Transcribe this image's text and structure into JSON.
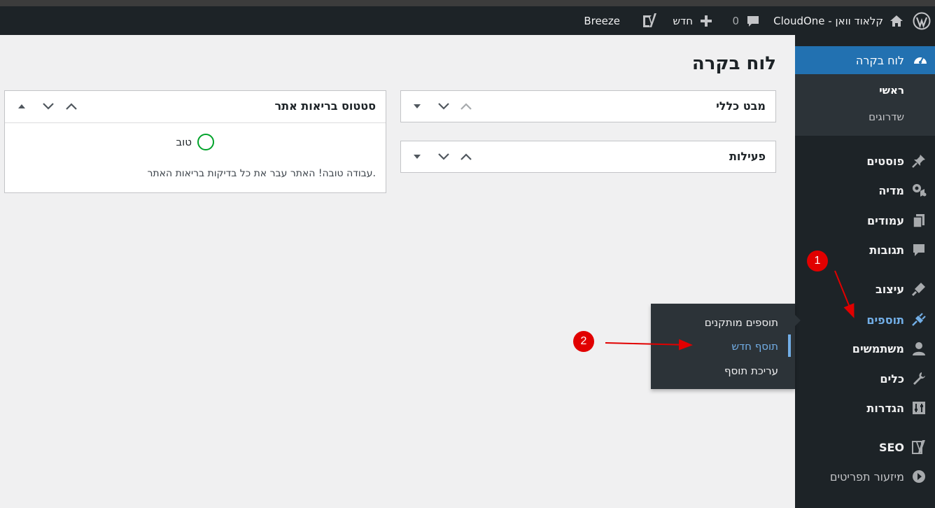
{
  "adminbar": {
    "site_name": "CloudOne - קלאוד וואן",
    "comments_count": "0",
    "new_label": "חדש",
    "breeze_label": "Breeze"
  },
  "sidebar": {
    "dashboard_label": "לוח בקרה",
    "dashboard_submenu": {
      "main": "ראשי",
      "upgrades": "שדרוגים"
    },
    "items": [
      {
        "label": "פוסטים",
        "icon": "pin-icon"
      },
      {
        "label": "מדיה",
        "icon": "media-icon"
      },
      {
        "label": "עמודים",
        "icon": "pages-icon"
      },
      {
        "label": "תגובות",
        "icon": "comments-icon"
      },
      {
        "label": "עיצוב",
        "icon": "appearance-icon"
      },
      {
        "label": "תוספים",
        "icon": "plugins-icon"
      },
      {
        "label": "משתמשים",
        "icon": "users-icon"
      },
      {
        "label": "כלים",
        "icon": "tools-icon"
      },
      {
        "label": "הגדרות",
        "icon": "settings-icon"
      },
      {
        "label": "SEO",
        "icon": "yoast-icon"
      },
      {
        "label": "מיזעור תפריטים",
        "icon": "collapse-icon"
      }
    ]
  },
  "plugins_flyout": {
    "items": [
      "תוספים מותקנים",
      "תוסף חדש",
      "עריכת תוסף"
    ]
  },
  "main": {
    "page_title": "לוח בקרה",
    "widgets": {
      "overview": "מבט כללי",
      "activity": "פעילות",
      "site_health": "סטטוס בריאות אתר"
    },
    "site_health": {
      "status": "טוב",
      "message": "עבודה טובה! האתר עבר את כל בדיקות בריאות האתר."
    }
  },
  "annotations": {
    "step1": "1",
    "step2": "2"
  },
  "colors": {
    "accent": "#2271b1",
    "active_link": "#72aee6",
    "health_good": "#00a32a",
    "annotation": "#e10000"
  }
}
